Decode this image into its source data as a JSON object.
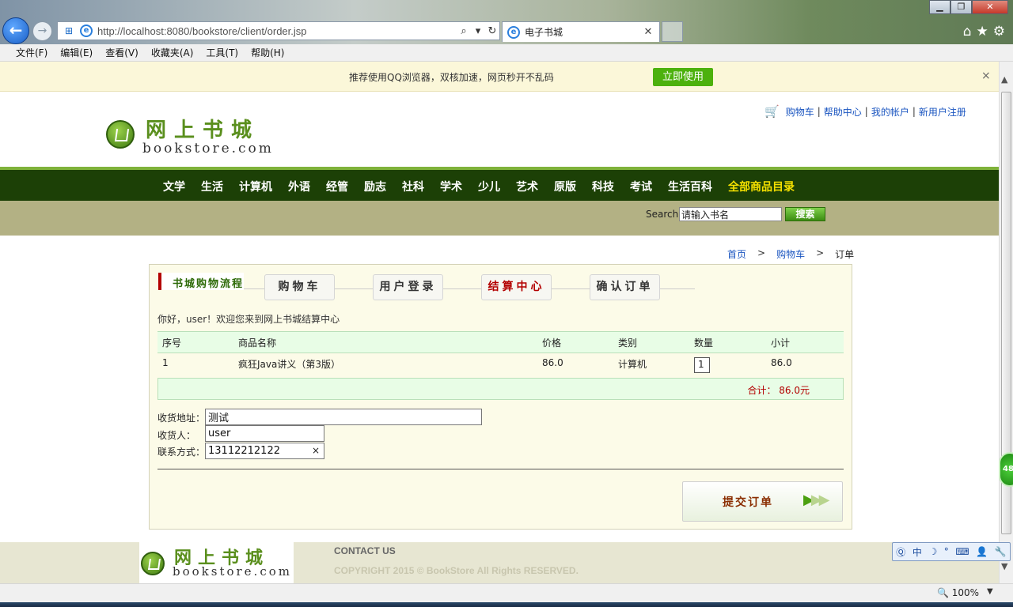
{
  "browser": {
    "url": "http://localhost:8080/bookstore/client/order.jsp",
    "tab_title": "电子书城",
    "tab_close": "✕",
    "back_icon": "arrow-left-icon",
    "menu": [
      "文件(F)",
      "编辑(E)",
      "查看(V)",
      "收藏夹(A)",
      "工具(T)",
      "帮助(H)"
    ],
    "window_buttons": {
      "minimize": "▁",
      "maximize": "❐",
      "close": "✕"
    },
    "zoom": "100%"
  },
  "infobar": {
    "text": "推荐使用QQ浏览器，双核加速，网页秒开不乱码",
    "button": "立即使用",
    "close": "×"
  },
  "site": {
    "logo_cn": "网上书城",
    "logo_en": "bookstore.com",
    "top_links": [
      "购物车",
      "帮助中心",
      "我的帐户",
      "新用户注册"
    ],
    "nav": [
      "文学",
      "生活",
      "计算机",
      "外语",
      "经管",
      "励志",
      "社科",
      "学术",
      "少儿",
      "艺术",
      "原版",
      "科技",
      "考试",
      "生活百科"
    ],
    "nav_all": "全部商品目录",
    "search_label": "Search",
    "search_value": "请输入书名",
    "search_button": "搜索"
  },
  "breadcrumb": {
    "home": "首页",
    "cart": "购物车",
    "current": "订单",
    "sep": ">"
  },
  "order": {
    "steps_title": "书城购物流程",
    "steps": [
      "购物车",
      "用户登录",
      "结算中心",
      "确认订单"
    ],
    "active_step": 2,
    "greeting": "你好，user！欢迎您来到网上书城结算中心",
    "columns": [
      "序号",
      "商品名称",
      "价格",
      "类别",
      "数量",
      "小计"
    ],
    "rows": [
      {
        "no": "1",
        "name": "疯狂Java讲义（第3版）",
        "price": "86.0",
        "category": "计算机",
        "qty": "1",
        "subtotal": "86.0"
      }
    ],
    "total": "合计：  86.0元",
    "address_label": "收货地址：",
    "address_value": "测试",
    "receiver_label": "收货人：",
    "receiver_value": "user",
    "phone_label": "联系方式：",
    "phone_value": "13112212122",
    "clear_icon": "×",
    "submit": "提交订单"
  },
  "footer": {
    "contact": "CONTACT US",
    "copyright": "COPYRIGHT 2015 © BookStore All Rights RESERVED."
  },
  "widgets": {
    "green_badge": "48",
    "ime": [
      "中",
      "☽",
      "°",
      "⌨",
      "👤",
      "🔧"
    ]
  }
}
